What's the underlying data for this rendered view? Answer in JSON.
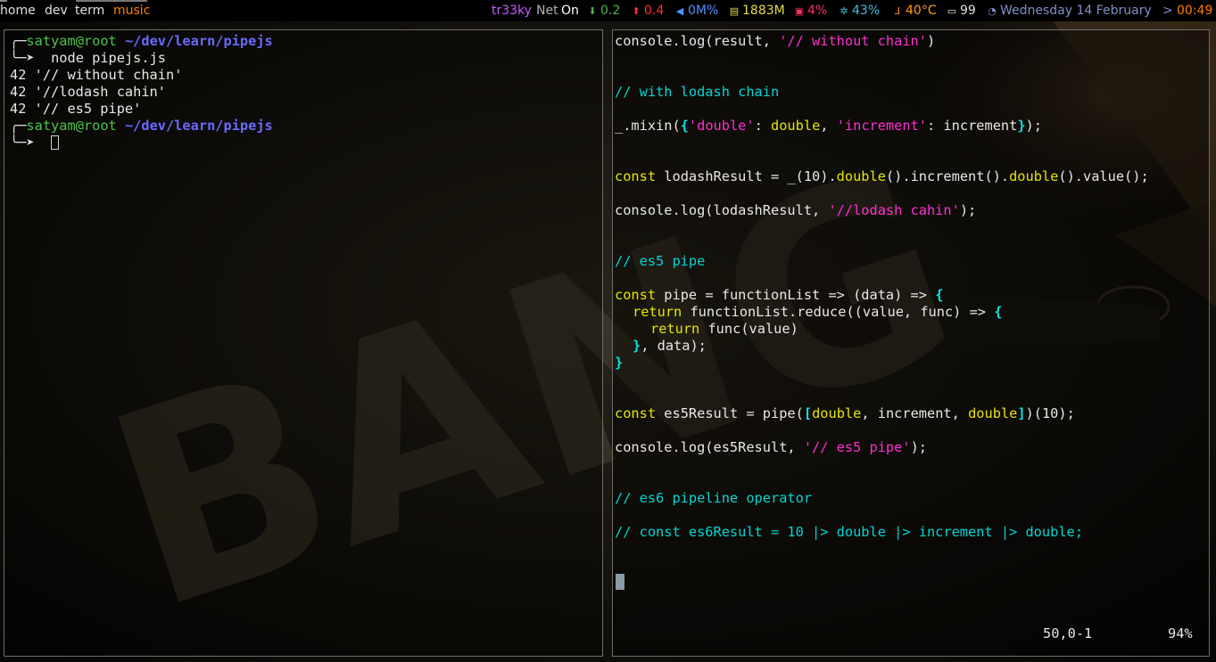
{
  "topbar": {
    "workspaces": [
      "home",
      "dev",
      "term",
      "music"
    ],
    "active_workspace": "music",
    "user": "tr33ky",
    "net_label": "Net",
    "net_state": "On",
    "down_icon": "arrow-down-icon",
    "down": "0.2",
    "up_icon": "arrow-up-icon",
    "up": "0.4",
    "volume_icon": "speaker-icon",
    "volume": "0M%",
    "memory_icon": "memory-icon",
    "memory": "1883M",
    "cpu_icon": "cpu-icon",
    "cpu": "4%",
    "fan_icon": "fan-icon",
    "fan": "43%",
    "temp_icon": "thermometer-icon",
    "temp": "40°C",
    "battery_icon": "battery-icon",
    "battery": "99",
    "clock_icon": "clock-icon",
    "date": "Wednesday 14 February",
    "separator": ">",
    "time": "00:49"
  },
  "terminal": {
    "prompt_user": "satyam",
    "prompt_at": "@",
    "prompt_host": "root",
    "prompt_path": "~/dev/learn/pipejs",
    "command": "node pipejs.js",
    "output": [
      "42 '// without chain'",
      "42 '//lodash cahin'",
      "42 '// es5 pipe'"
    ]
  },
  "editor": {
    "line_console_result": [
      "console.log(result, ",
      "'// without chain'",
      ")"
    ],
    "comment_lodash": "// with lodash chain",
    "mixin": [
      "_.mixin(",
      "{",
      "'double'",
      ": ",
      "double",
      ", ",
      "'increment'",
      ": increment",
      "}",
      ");"
    ],
    "lodash_result": [
      "const",
      " lodashResult = _(10).",
      "double",
      "().increment().",
      "double",
      "().value();"
    ],
    "console_lodash": [
      "console.log(lodashResult, ",
      "'//lodash cahin'",
      ");"
    ],
    "comment_es5": "// es5 pipe",
    "pipe_decl": [
      "const",
      " pipe = functionList => (data) => ",
      "{"
    ],
    "pipe_return": [
      "return",
      " functionList.reduce((value, func) => ",
      "{"
    ],
    "pipe_inner": [
      "return",
      " func(value)"
    ],
    "pipe_close_inner": [
      "}",
      ", data);"
    ],
    "pipe_close": "}",
    "es5_result": [
      "const",
      " es5Result = pipe(",
      "[",
      "double",
      ", increment, ",
      "double",
      "]",
      ")(10);"
    ],
    "console_es5": [
      "console.log(es5Result, ",
      "'// es5 pipe'",
      ");"
    ],
    "comment_es6": "// es6 pipeline operator",
    "comment_es6_code": "// const es6Result = 10 |> double |> increment |> double;",
    "ruler_position": "50,0-1",
    "ruler_percent": "94%"
  },
  "wallpaper": {
    "text": "BANG"
  },
  "colors": {
    "workspace": "#e0e0e0",
    "active_workspace": "#ff7f00",
    "user": "#c45bff",
    "net_label": "#b0b0b0",
    "net_state": "#ffffff",
    "down": "#4fb14f",
    "up": "#ff3030",
    "volume": "#4f8fff",
    "memory": "#e6d84a",
    "cpu": "#ff3060",
    "fan": "#40c0e0",
    "temp": "#ff9a20",
    "battery": "#e0e0e0",
    "date": "#8090c8",
    "time": "#ff7a00"
  }
}
